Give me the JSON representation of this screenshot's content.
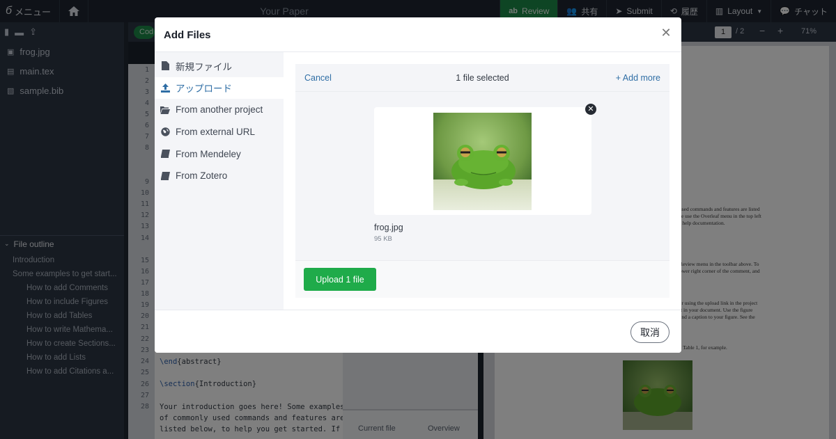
{
  "topbar": {
    "menu_label": "メニュー",
    "title": "Your Paper",
    "review_label": "Review",
    "share_label": "共有",
    "submit_label": "Submit",
    "history_label": "履歴",
    "layout_label": "Layout",
    "chat_label": "チャット"
  },
  "file_tree": {
    "files": [
      "frog.jpg",
      "main.tex",
      "sample.bib"
    ]
  },
  "outline": {
    "heading": "File outline",
    "items": [
      "Introduction",
      "Some examples to get start...",
      "How to add Comments",
      "How to include Figures",
      "How to add Tables",
      "How to write Mathema...",
      "How to create Sections...",
      "How to add Lists",
      "How to add Citations a..."
    ]
  },
  "editor": {
    "code_toggle": "Cod",
    "line_numbers": [
      "1",
      "2",
      "3",
      "4",
      "5",
      "6",
      "7",
      "8",
      "9",
      "10",
      "11",
      "12",
      "13",
      "14",
      "15",
      "16",
      "17",
      "18",
      "19",
      "20",
      "21",
      "22",
      "23",
      "24",
      "25",
      "26",
      "27",
      "28"
    ],
    "lines": {
      "end_cmd": "\\end",
      "end_arg": "{abstract}",
      "section_cmd": "\\section",
      "section_arg": "{Introduction}",
      "intro1": "Your introduction goes here! Some examples",
      "intro2": "of commonly used commands and features are",
      "intro3": "listed below, to help you get started. If"
    }
  },
  "review_panel": {
    "tab_current": "Current file",
    "tab_overview": "Overview"
  },
  "pdf": {
    "page_current": "1",
    "page_total": "/ 2",
    "zoom": "71%",
    "snippets": [
      "used commands and features are listed",
      "se use the Overleaf menu in the top left",
      "r help documentation.",
      "Review menu in the toolbar above. To",
      "ower right corner of the comment, and",
      "er using the upload link in the project",
      "it in your document. Use the figure",
      "and a caption to your figure. See the",
      "e Table 1, for example."
    ]
  },
  "modal": {
    "title": "Add Files",
    "sources": [
      {
        "label": "新規ファイル",
        "icon": "file-icon"
      },
      {
        "label": "アップロード",
        "icon": "upload-icon"
      },
      {
        "label": "From another project",
        "icon": "folder-open-icon"
      },
      {
        "label": "From external URL",
        "icon": "globe-icon"
      },
      {
        "label": "From Mendeley",
        "icon": "book-icon"
      },
      {
        "label": "From Zotero",
        "icon": "book-icon"
      }
    ],
    "active_source": "アップロード",
    "uploader": {
      "cancel_label": "Cancel",
      "selected_count": "1 file selected",
      "add_more_label": "+ Add more",
      "file": {
        "name": "frog.jpg",
        "size": "95 KB"
      },
      "upload_label": "Upload 1 file"
    },
    "close_label": "取消"
  },
  "colors": {
    "accent_link": "#2f6ea5",
    "upload_green": "#1fab4a",
    "review_green": "#1d8a48"
  }
}
